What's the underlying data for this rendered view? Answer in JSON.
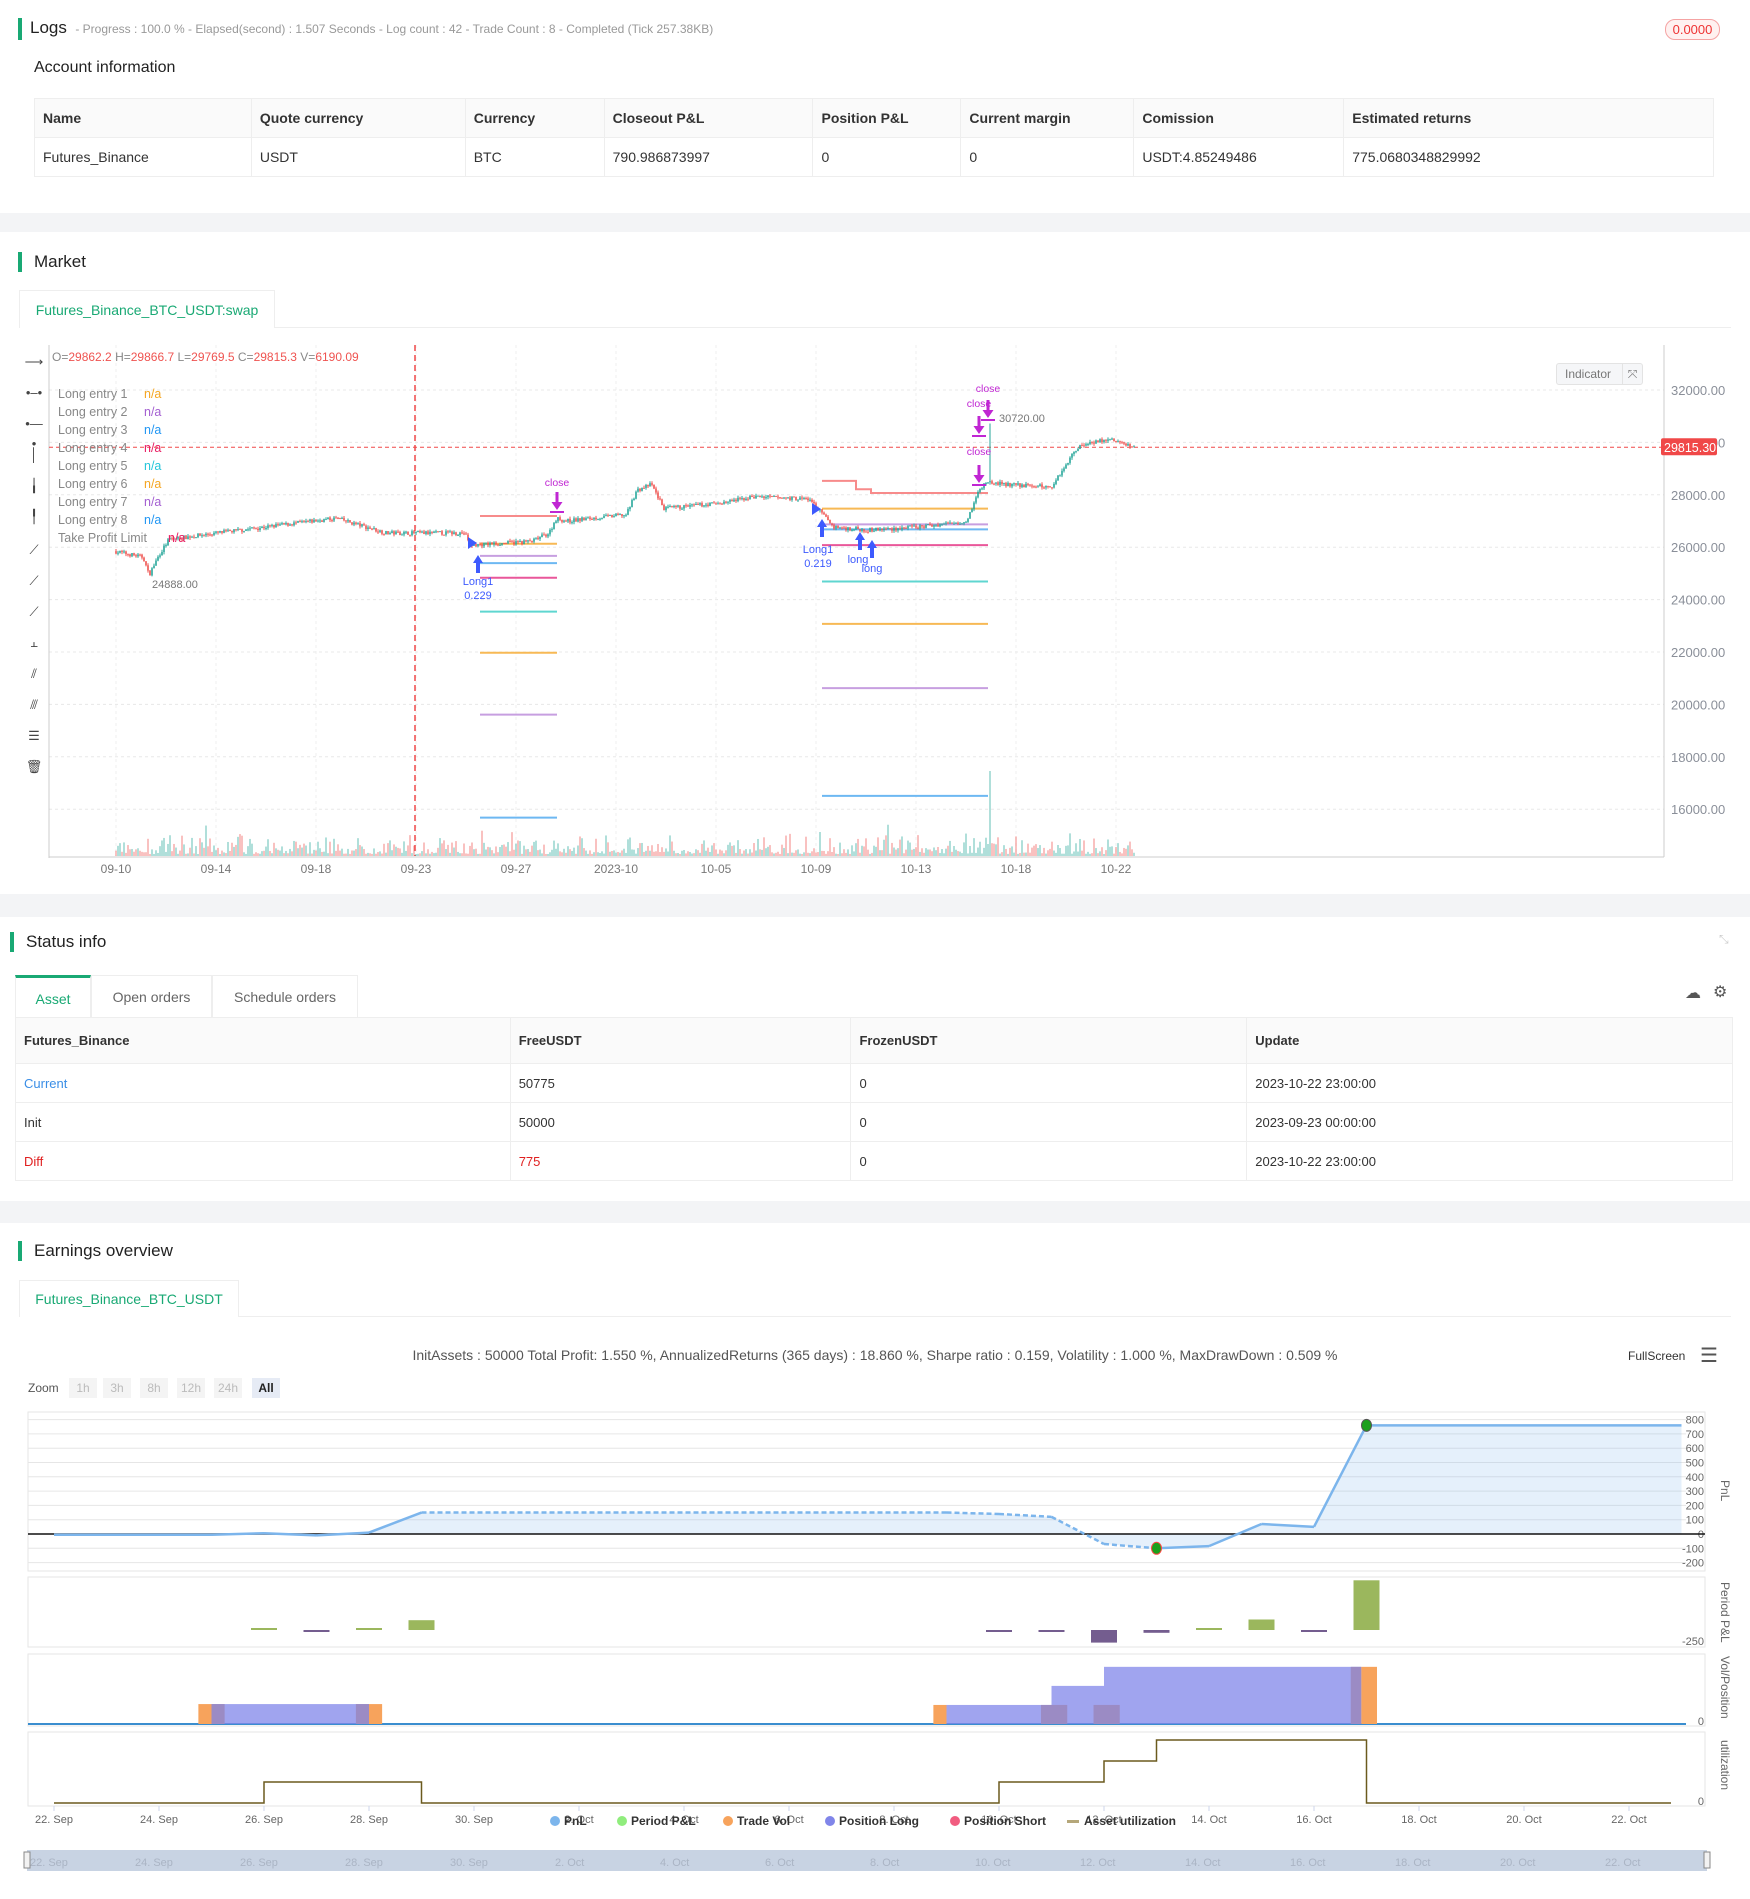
{
  "logs": {
    "title": "Logs",
    "summary": "- Progress : 100.0 % - Elapsed(second) : 1.507  Seconds - Log count : 42 - Trade Count : 8 - Completed (Tick 257.38KB)",
    "badge": "0.0000"
  },
  "account": {
    "title": "Account information",
    "headers": [
      "Name",
      "Quote currency",
      "Currency",
      "Closeout P&L",
      "Position P&L",
      "Current margin",
      "Comission",
      "Estimated returns"
    ],
    "row": [
      "Futures_Binance",
      "USDT",
      "BTC",
      "790.986873997",
      "0",
      "0",
      "USDT:4.85249486",
      "775.0680348829992"
    ]
  },
  "market": {
    "title": "Market",
    "tab": "Futures_Binance_BTC_USDT:swap",
    "ohlcv": {
      "o_label": "O=",
      "o": "29862.2",
      "h_label": " H=",
      "h": "29866.7",
      "l_label": " L=",
      "l": "29769.5",
      "c_label": " C=",
      "c": "29815.3",
      "v_label": " V=",
      "v": "6190.09"
    },
    "legend": [
      {
        "label": "Long entry 1",
        "value": "n/a",
        "color": "#f5a623"
      },
      {
        "label": "Long entry 2",
        "value": "n/a",
        "color": "#a35fd1"
      },
      {
        "label": "Long entry 3",
        "value": "n/a",
        "color": "#2196f3"
      },
      {
        "label": "Long entry 4",
        "value": "n/a",
        "color": "#e91e63"
      },
      {
        "label": "Long entry 5",
        "value": "n/a",
        "color": "#26c6da"
      },
      {
        "label": "Long entry 6",
        "value": "n/a",
        "color": "#f5a623"
      },
      {
        "label": "Long entry 7",
        "value": "n/a",
        "color": "#a35fd1"
      },
      {
        "label": "Long entry 8",
        "value": "n/a",
        "color": "#2196f3"
      },
      {
        "label": "Take Profit Limit",
        "value": "n/a",
        "color": "#e91e63"
      }
    ],
    "indicator_label": "Indicator",
    "price_ticks": [
      "32000.00",
      "30000.00",
      "28000.00",
      "26000.00",
      "24000.00",
      "22000.00",
      "20000.00",
      "18000.00",
      "16000.00"
    ],
    "last_price": "29815.30",
    "date_ticks": [
      "09-10",
      "09-14",
      "09-18",
      "09-23",
      "09-27",
      "2023-10",
      "10-05",
      "10-09",
      "10-13",
      "10-18",
      "10-22"
    ],
    "low_label": "24888.00",
    "high_label": "30720.00",
    "price_path": [
      [
        0,
        25850
      ],
      [
        1.17,
        25620
      ],
      [
        1.4,
        24925
      ],
      [
        1.8,
        25700
      ],
      [
        2.2,
        26300
      ],
      [
        4.1,
        26540
      ],
      [
        8,
        27000
      ],
      [
        8.9,
        27100
      ],
      [
        10.9,
        26540
      ],
      [
        14,
        26540
      ],
      [
        14.3,
        26080
      ],
      [
        16.7,
        26220
      ],
      [
        17.4,
        26540
      ],
      [
        17.7,
        27100
      ],
      [
        18.1,
        27000
      ],
      [
        20.5,
        27240
      ],
      [
        20.9,
        28160
      ],
      [
        21.5,
        28400
      ],
      [
        22,
        27470
      ],
      [
        24.4,
        27700
      ],
      [
        25.6,
        27930
      ],
      [
        27.8,
        27840
      ],
      [
        28.8,
        26770
      ],
      [
        30.2,
        26650
      ],
      [
        32.2,
        26770
      ],
      [
        34.1,
        27000
      ],
      [
        34.6,
        28160
      ],
      [
        34.9,
        28500
      ],
      [
        35.6,
        28400
      ],
      [
        37.5,
        28300
      ],
      [
        38.5,
        29780
      ],
      [
        39,
        30010
      ],
      [
        39.9,
        30100
      ],
      [
        40.8,
        29815
      ]
    ],
    "levels": [
      {
        "from": 14.56,
        "to": 17.64,
        "prices": [
          27190,
          26130,
          25670,
          25390,
          24835,
          23540,
          21970,
          19610,
          15680
        ]
      },
      {
        "from": 28.24,
        "to": 34.88,
        "prices": [
          28530,
          27470,
          26870,
          26680,
          26080,
          24690,
          23075,
          20620,
          16510
        ]
      }
    ],
    "level_colors": [
      "#f78b8b",
      "#f7b955",
      "#c79fe0",
      "#6db8f2",
      "#e9579a",
      "#5fd6d0",
      "#f7b955",
      "#c79fe0",
      "#6db8f2"
    ],
    "markers": {
      "long": [
        {
          "label": "Long1",
          "qty": "0.229"
        },
        {
          "label": "Long1",
          "qty": "0.219"
        },
        {
          "label": "long"
        },
        {
          "label": "long"
        }
      ],
      "close": [
        "close",
        "close",
        "close",
        "close"
      ]
    }
  },
  "status": {
    "title": "Status info",
    "tabs": [
      "Asset",
      "Open orders",
      "Schedule orders"
    ],
    "headers": [
      "Futures_Binance",
      "FreeUSDT",
      "FrozenUSDT",
      "Update"
    ],
    "rows": [
      [
        "Current",
        "50775",
        "0",
        "2023-10-22 23:00:00"
      ],
      [
        "Init",
        "50000",
        "0",
        "2023-09-23 00:00:00"
      ],
      [
        "Diff",
        "775",
        "0",
        "2023-10-22 23:00:00"
      ]
    ]
  },
  "earnings": {
    "title": "Earnings overview",
    "tab": "Futures_Binance_BTC_USDT",
    "stats": "InitAssets : 50000 Total Profit: 1.550 %, AnnualizedReturns (365 days) : 18.860 %, Sharpe ratio : 0.159, Volatility : 1.000 %, MaxDrawDown : 0.509 %",
    "fullscreen": "FullScreen",
    "zoom_label": "Zoom",
    "zoom_buttons": [
      "1h",
      "3h",
      "8h",
      "12h",
      "24h",
      "All"
    ],
    "pnl_ticks": [
      "800",
      "700",
      "600",
      "500",
      "400",
      "300",
      "200",
      "100",
      "0",
      "-100",
      "-200"
    ],
    "period_tick": "-250",
    "vol_tick": "0",
    "util_tick": "0",
    "axis_titles": [
      "PnL",
      "Period P&L",
      "Vol/Position",
      "utilization"
    ],
    "x_ticks": [
      "22. Sep",
      "24. Sep",
      "26. Sep",
      "28. Sep",
      "30. Sep",
      "2. Oct",
      "4. Oct",
      "6. Oct",
      "8. Oct",
      "10. Oct",
      "12. Oct",
      "14. Oct",
      "16. Oct",
      "18. Oct",
      "20. Oct",
      "22. Oct"
    ],
    "legend": [
      {
        "label": "PnL",
        "color": "#7cb5ec"
      },
      {
        "label": "Period P&L",
        "color": "#90ed7d"
      },
      {
        "label": "Trade Vol",
        "color": "#f7a35c"
      },
      {
        "label": "Position Long",
        "color": "#8085e9"
      },
      {
        "label": "Position Short",
        "color": "#f15c80"
      },
      {
        "label": "Asset utilization",
        "color": "#b5a77a"
      }
    ],
    "chart_data": {
      "pnl": [
        [
          0,
          -5
        ],
        [
          3,
          -5
        ],
        [
          4,
          5
        ],
        [
          5,
          -10
        ],
        [
          6,
          10
        ],
        [
          7,
          150
        ],
        [
          17,
          150
        ],
        [
          18,
          140
        ],
        [
          19,
          120
        ],
        [
          20,
          -70
        ],
        [
          21,
          -100
        ],
        [
          22,
          -85
        ],
        [
          23,
          70
        ],
        [
          24,
          50
        ],
        [
          25,
          760
        ],
        [
          31,
          760
        ]
      ],
      "pnl_dashed_range": [
        7,
        21
      ],
      "period_pnl": [
        [
          4,
          3
        ],
        [
          5,
          -5
        ],
        [
          6,
          8
        ],
        [
          7,
          140
        ],
        [
          18,
          -5
        ],
        [
          19,
          -5
        ],
        [
          20,
          -180
        ],
        [
          21,
          -40
        ],
        [
          22,
          15
        ],
        [
          23,
          150
        ],
        [
          24,
          -20
        ],
        [
          25,
          710
        ]
      ],
      "position_long": [
        [
          3,
          6,
          0.229
        ],
        [
          17,
          19,
          0.219
        ],
        [
          19,
          20,
          0.438
        ],
        [
          20,
          24.9,
          0.657
        ]
      ],
      "trade_vol": [
        [
          2.75,
          3,
          0.229
        ],
        [
          6,
          6.25,
          0.229
        ],
        [
          16.75,
          17,
          0.219
        ],
        [
          24.9,
          25.2,
          0.657
        ]
      ],
      "overlap": [
        [
          3,
          3.25,
          0.229
        ],
        [
          5.75,
          6,
          0.229
        ],
        [
          18.8,
          19.3,
          0.219
        ],
        [
          19.8,
          20.3,
          0.219
        ],
        [
          24.7,
          24.9,
          0.657
        ]
      ],
      "utilization": [
        [
          0,
          0
        ],
        [
          4,
          1
        ],
        [
          7,
          0
        ],
        [
          18,
          1
        ],
        [
          20,
          2
        ],
        [
          21,
          3
        ],
        [
          25,
          0
        ],
        [
          30.8,
          0
        ]
      ]
    }
  }
}
